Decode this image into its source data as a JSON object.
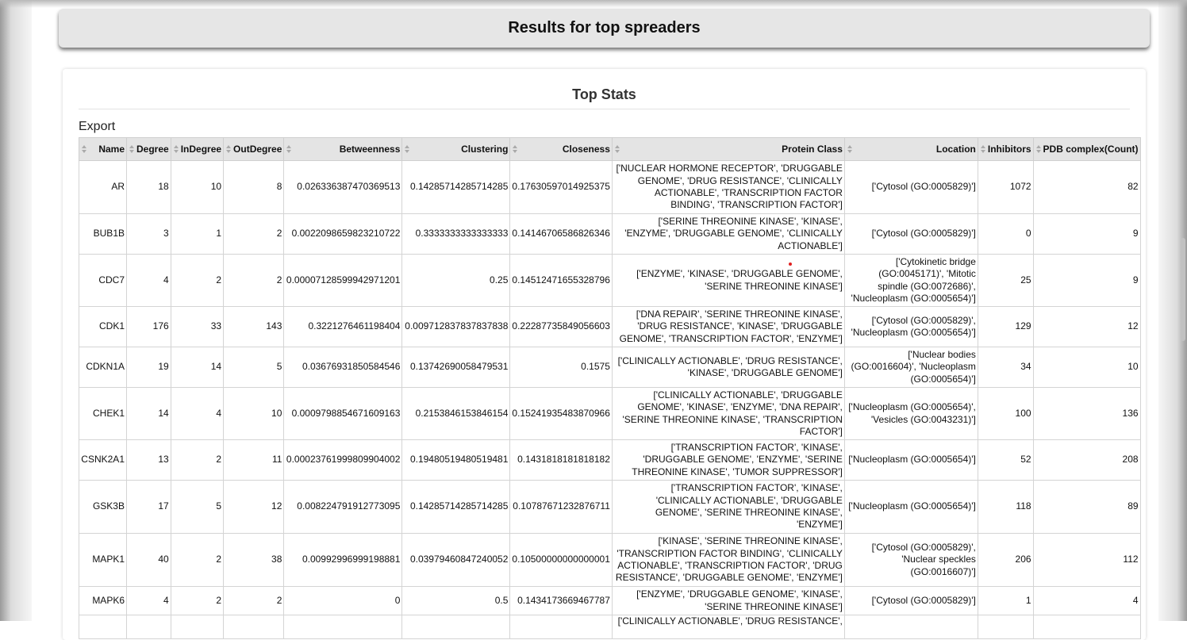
{
  "header": {
    "title": "Results for top spreaders"
  },
  "card": {
    "title": "Top Stats",
    "export_label": "Export"
  },
  "table": {
    "columns": [
      "Name",
      "Degree",
      "InDegree",
      "OutDegree",
      "Betweenness",
      "Clustering",
      "Closeness",
      "Protein Class",
      "Location",
      "Inhibitors",
      "PDB complex(Count)"
    ],
    "rows": [
      [
        "AR",
        "18",
        "10",
        "8",
        "0.026336387470369513",
        "0.14285714285714285",
        "0.17630597014925375",
        "['NUCLEAR HORMONE RECEPTOR', 'DRUGGABLE GENOME', 'DRUG RESISTANCE', 'CLINICALLY ACTIONABLE', 'TRANSCRIPTION FACTOR BINDING', 'TRANSCRIPTION FACTOR']",
        "['Cytosol (GO:0005829)']",
        "1072",
        "82"
      ],
      [
        "BUB1B",
        "3",
        "1",
        "2",
        "0.0022098659823210722",
        "0.3333333333333333",
        "0.14146706586826346",
        "['SERINE THREONINE KINASE', 'KINASE', 'ENZYME', 'DRUGGABLE GENOME', 'CLINICALLY ACTIONABLE']",
        "['Cytosol (GO:0005829)']",
        "0",
        "9"
      ],
      [
        "CDC7",
        "4",
        "2",
        "2",
        "0.00007128599942971201",
        "0.25",
        "0.14512471655328796",
        "['ENZYME', 'KINASE', 'DRUGGABLE GENOME', 'SERINE THREONINE KINASE']",
        "['Cytokinetic bridge (GO:0045171)', 'Mitotic spindle (GO:0072686)', 'Nucleoplasm (GO:0005654)']",
        "25",
        "9"
      ],
      [
        "CDK1",
        "176",
        "33",
        "143",
        "0.3221276461198404",
        "0.009712837837837838",
        "0.22287735849056603",
        "['DNA REPAIR', 'SERINE THREONINE KINASE', 'DRUG RESISTANCE', 'KINASE', 'DRUGGABLE GENOME', 'TRANSCRIPTION FACTOR', 'ENZYME']",
        "['Cytosol (GO:0005829)', 'Nucleoplasm (GO:0005654)']",
        "129",
        "12"
      ],
      [
        "CDKN1A",
        "19",
        "14",
        "5",
        "0.03676931850584546",
        "0.13742690058479531",
        "0.1575",
        "['CLINICALLY ACTIONABLE', 'DRUG RESISTANCE', 'KINASE', 'DRUGGABLE GENOME']",
        "['Nuclear bodies (GO:0016604)', 'Nucleoplasm (GO:0005654)']",
        "34",
        "10"
      ],
      [
        "CHEK1",
        "14",
        "4",
        "10",
        "0.0009798854671609163",
        "0.2153846153846154",
        "0.15241935483870966",
        "['CLINICALLY ACTIONABLE', 'DRUGGABLE GENOME', 'KINASE', 'ENZYME', 'DNA REPAIR', 'SERINE THREONINE KINASE', 'TRANSCRIPTION FACTOR']",
        "['Nucleoplasm (GO:0005654)', 'Vesicles (GO:0043231)']",
        "100",
        "136"
      ],
      [
        "CSNK2A1",
        "13",
        "2",
        "11",
        "0.00023761999809904002",
        "0.19480519480519481",
        "0.1431818181818182",
        "['TRANSCRIPTION FACTOR', 'KINASE', 'DRUGGABLE GENOME', 'ENZYME', 'SERINE THREONINE KINASE', 'TUMOR SUPPRESSOR']",
        "['Nucleoplasm (GO:0005654)']",
        "52",
        "208"
      ],
      [
        "GSK3B",
        "17",
        "5",
        "12",
        "0.008224791912773095",
        "0.14285714285714285",
        "0.10787671232876711",
        "['TRANSCRIPTION FACTOR', 'KINASE', 'CLINICALLY ACTIONABLE', 'DRUGGABLE GENOME', 'SERINE THREONINE KINASE', 'ENZYME']",
        "['Nucleoplasm (GO:0005654)']",
        "118",
        "89"
      ],
      [
        "MAPK1",
        "40",
        "2",
        "38",
        "0.00992996999198881",
        "0.03979460847240052",
        "0.10500000000000001",
        "['KINASE', 'SERINE THREONINE KINASE', 'TRANSCRIPTION FACTOR BINDING', 'CLINICALLY ACTIONABLE', 'TRANSCRIPTION FACTOR', 'DRUG RESISTANCE', 'DRUGGABLE GENOME', 'ENZYME']",
        "['Cytosol (GO:0005829)', 'Nuclear speckles (GO:0016607)']",
        "206",
        "112"
      ],
      [
        "MAPK6",
        "4",
        "2",
        "2",
        "0",
        "0.5",
        "0.1434173669467787",
        "['ENZYME', 'DRUGGABLE GENOME', 'KINASE', 'SERINE THREONINE KINASE']",
        "['Cytosol (GO:0005829)']",
        "1",
        "4"
      ],
      [
        "",
        "",
        "",
        "",
        "",
        "",
        "",
        "['CLINICALLY ACTIONABLE', 'DRUG RESISTANCE',",
        "",
        "",
        ""
      ]
    ]
  }
}
